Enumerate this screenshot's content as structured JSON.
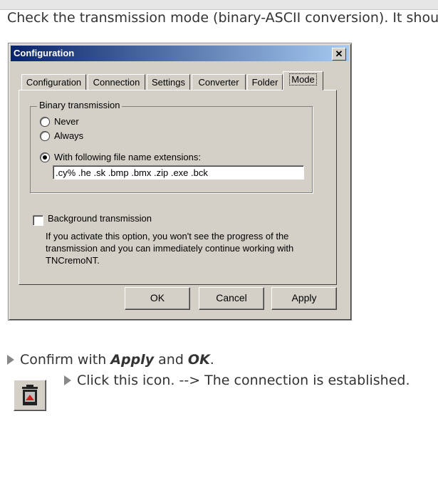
{
  "intro_text": "Check the transmission mode (binary-ASCII conversion). It should",
  "dialog": {
    "title": "Configuration",
    "close_label": "✕",
    "tabs": [
      "Configuration",
      "Connection",
      "Settings",
      "Converter",
      "Folder",
      "Mode"
    ],
    "active_tab": "Mode",
    "binary_group_label": "Binary transmission",
    "radio_never": "Never",
    "radio_always": "Always",
    "radio_extensions": "With following file name extensions:",
    "selected_radio": "With following file name extensions:",
    "extensions_value": ".cy% .he .sk .bmp .bmx .zip .exe .bck",
    "background_label": "Background transmission",
    "background_checked": false,
    "background_desc": "If you activate this option, you won't see the progress of the transmission and you can immediately continue working with TNCremoNT.",
    "ok_label": "OK",
    "cancel_label": "Cancel",
    "apply_label": "Apply"
  },
  "instructions": {
    "confirm_prefix": "Confirm with ",
    "confirm_apply": "Apply",
    "confirm_and": " and ",
    "confirm_ok": "OK",
    "confirm_suffix": ".",
    "click_text": "Click this icon. --> The connection is established."
  },
  "icon": {
    "name": "connection-icon"
  },
  "colors": {
    "titlebar_start": "#0a246a",
    "titlebar_end": "#a6caf0",
    "dialog_bg": "#d4d0c8"
  }
}
